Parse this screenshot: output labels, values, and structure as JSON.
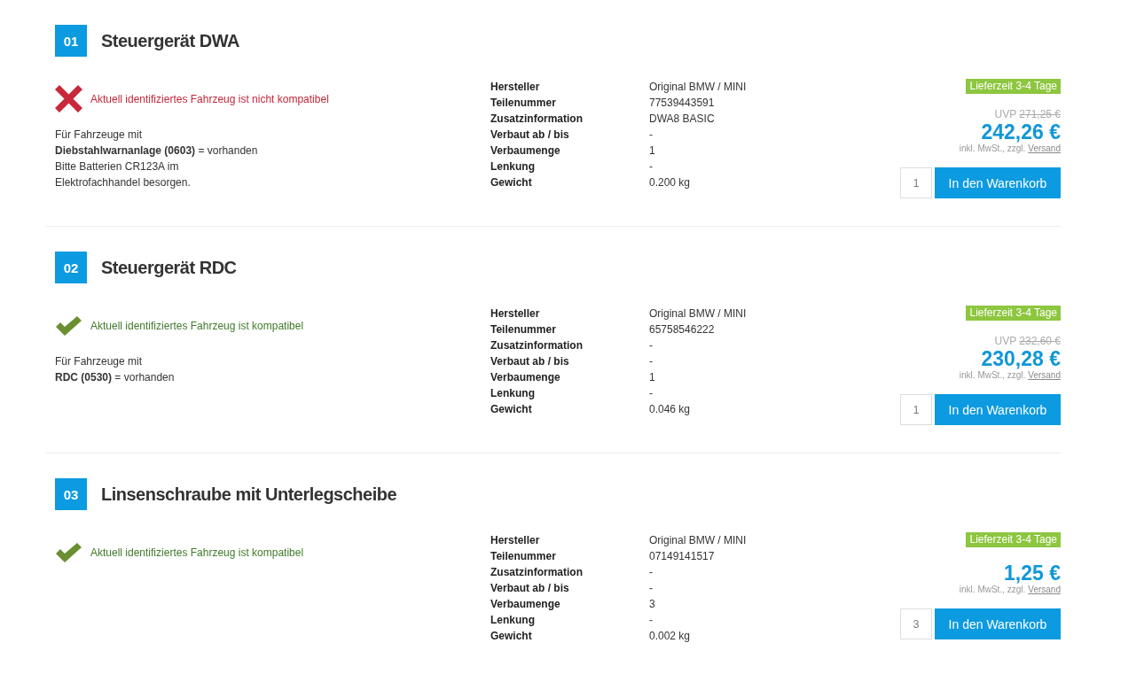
{
  "items": [
    {
      "number": "01",
      "title": "Steuergerät DWA",
      "compatible": false,
      "compatibility_text": "Aktuell identifiziertes Fahrzeug ist nicht kompatibel",
      "notes": [
        "Für Fahrzeuge mit",
        "**Diebstahlwarnanlage (0603)** = vorhanden",
        "Bitte Batterien CR123A im",
        "Elektrofachhandel besorgen."
      ],
      "specs": [
        {
          "label": "Hersteller",
          "value": "Original BMW / MINI"
        },
        {
          "label": "Teilenummer",
          "value": "77539443591"
        },
        {
          "label": "Zusatzinformation",
          "value": "DWA8 BASIC"
        },
        {
          "label": "Verbaut ab / bis",
          "value": "-"
        },
        {
          "label": "Verbaumenge",
          "value": "1"
        },
        {
          "label": "Lenkung",
          "value": "-"
        },
        {
          "label": "Gewicht",
          "value": "0.200 kg"
        }
      ],
      "delivery": "Lieferzeit 3-4 Tage",
      "uvp_label": "UVP",
      "uvp": "271,25 €",
      "price": "242,26 €",
      "tax_note": "inkl. MwSt., zzgl.",
      "shipping_link": "Versand",
      "quantity": "1",
      "cart_button": "In den Warenkorb"
    },
    {
      "number": "02",
      "title": "Steuergerät RDC",
      "compatible": true,
      "compatibility_text": "Aktuell identifiziertes Fahrzeug ist kompatibel",
      "notes": [
        "Für Fahrzeuge mit",
        "**RDC (0530)** = vorhanden"
      ],
      "specs": [
        {
          "label": "Hersteller",
          "value": "Original BMW / MINI"
        },
        {
          "label": "Teilenummer",
          "value": "65758546222"
        },
        {
          "label": "Zusatzinformation",
          "value": "-"
        },
        {
          "label": "Verbaut ab / bis",
          "value": "-"
        },
        {
          "label": "Verbaumenge",
          "value": "1"
        },
        {
          "label": "Lenkung",
          "value": "-"
        },
        {
          "label": "Gewicht",
          "value": "0.046 kg"
        }
      ],
      "delivery": "Lieferzeit 3-4 Tage",
      "uvp_label": "UVP",
      "uvp": "232,60 €",
      "price": "230,28 €",
      "tax_note": "inkl. MwSt., zzgl.",
      "shipping_link": "Versand",
      "quantity": "1",
      "cart_button": "In den Warenkorb"
    },
    {
      "number": "03",
      "title": "Linsenschraube mit Unterlegscheibe",
      "compatible": true,
      "compatibility_text": "Aktuell identifiziertes Fahrzeug ist kompatibel",
      "specs": [
        {
          "label": "Hersteller",
          "value": "Original BMW / MINI"
        },
        {
          "label": "Teilenummer",
          "value": "07149141517"
        },
        {
          "label": "Zusatzinformation",
          "value": "-"
        },
        {
          "label": "Verbaut ab / bis",
          "value": "-"
        },
        {
          "label": "Verbaumenge",
          "value": "3"
        },
        {
          "label": "Lenkung",
          "value": "-"
        },
        {
          "label": "Gewicht",
          "value": "0.002 kg"
        }
      ],
      "delivery": "Lieferzeit 3-4 Tage",
      "price": "1,25 €",
      "tax_note": "inkl. MwSt., zzgl.",
      "shipping_link": "Versand",
      "quantity": "3",
      "cart_button": "In den Warenkorb"
    }
  ]
}
